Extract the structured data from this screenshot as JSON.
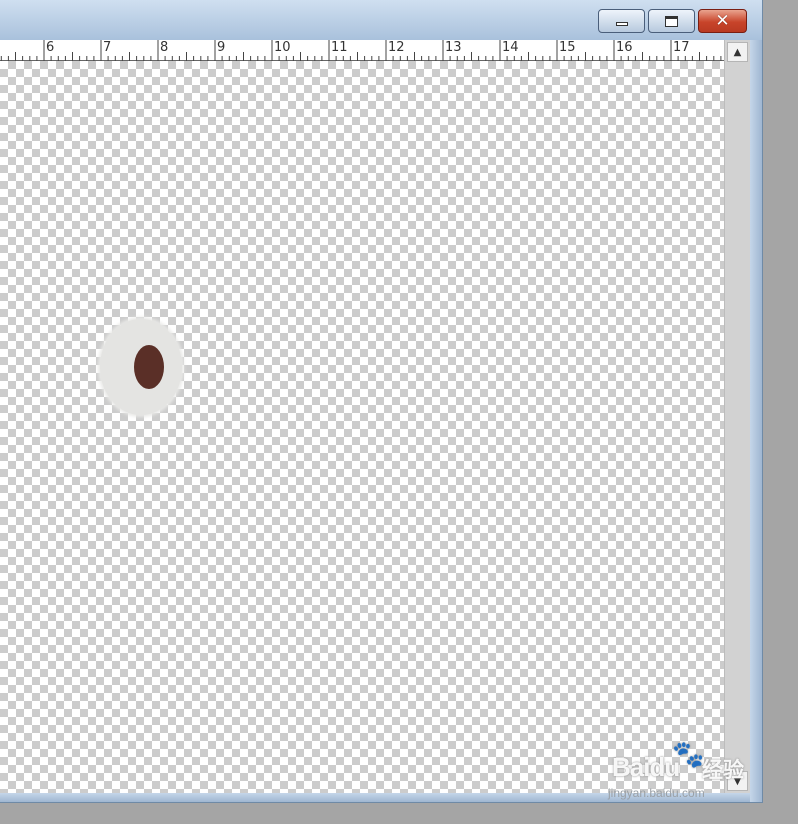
{
  "window": {
    "title_buttons": {
      "minimize": "minimize-icon",
      "maximize": "maximize-icon",
      "close": "close-icon",
      "close_glyph": "✕"
    }
  },
  "ruler": {
    "labels": [
      "6",
      "7",
      "8",
      "9",
      "10",
      "11",
      "12",
      "13",
      "14",
      "15",
      "16",
      "17"
    ]
  },
  "scrollbar": {
    "up_arrow": "▲",
    "down_arrow": "▼"
  },
  "canvas": {
    "background": "transparency-checkerboard",
    "colors": {
      "checker_light": "#ffffff",
      "checker_dark": "#cccccc",
      "blob_outer": "#e4e4e2",
      "blob_inner": "#5a2f27"
    }
  },
  "watermark": {
    "brand": "Bai",
    "brand_tail": "du",
    "paw": "🐾",
    "sub": "经验",
    "url": "jingyan.baidu.com"
  }
}
